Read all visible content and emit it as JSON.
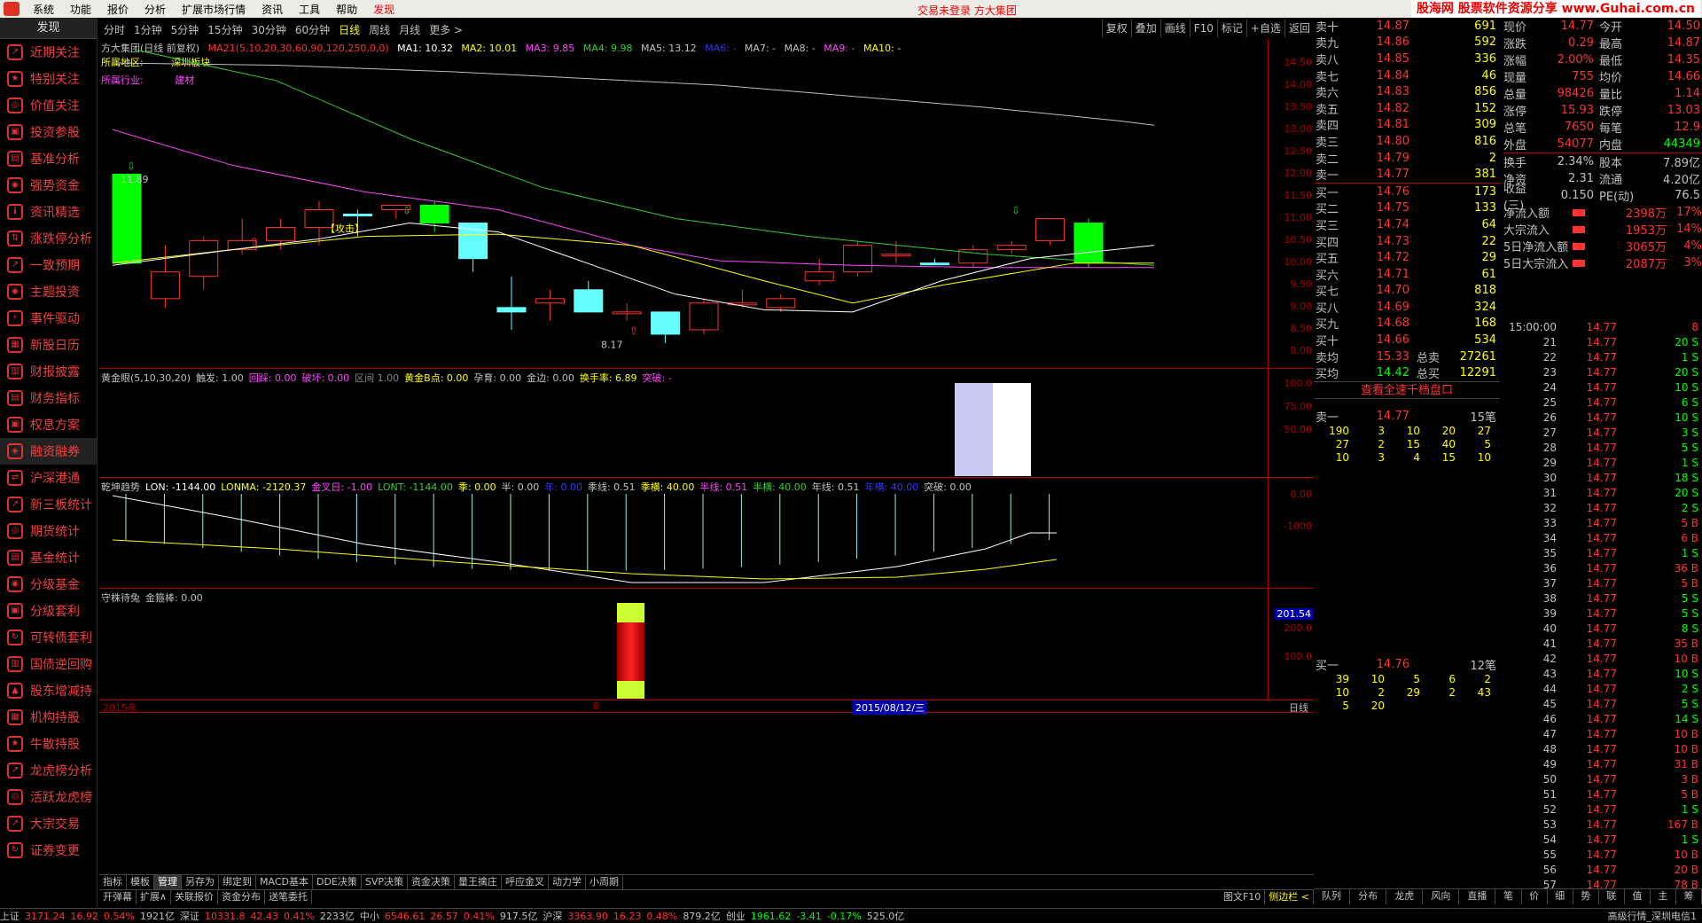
{
  "menubar": {
    "items": [
      "系统",
      "功能",
      "报价",
      "分析",
      "扩展市场行情",
      "资讯",
      "工具",
      "帮助",
      "发现"
    ],
    "status_text": "交易未登录    方大集团",
    "brand": "股海网 股票软件资源分享 www.Guhai.com.cn"
  },
  "sidebar": {
    "header": "发现",
    "items": [
      "近期关注",
      "特别关注",
      "价值关注",
      "投资参股",
      "基准分析",
      "强势资金",
      "资讯精选",
      "涨跌停分析",
      "一致预期",
      "主题投资",
      "事件驱动",
      "新股日历",
      "财报披露",
      "财务指标",
      "权息方案",
      "融资融券",
      "沪深港通",
      "新三板统计",
      "期货统计",
      "基金统计",
      "分级基金",
      "分级套利",
      "可转债套利",
      "国债逆回购",
      "股东增减持",
      "机构持股",
      "牛散持股",
      "龙虎榜分析",
      "活跃龙虎榜",
      "大宗交易",
      "证券变更"
    ]
  },
  "periods": [
    "分时",
    "1分钟",
    "5分钟",
    "15分钟",
    "30分钟",
    "60分钟",
    "日线",
    "周线",
    "月线",
    "更多 >"
  ],
  "right_tools": [
    "复权",
    "叠加",
    "画线",
    "F10",
    "标记",
    "+自选",
    "返回"
  ],
  "chart_header": {
    "name": "方大集团(日线 前复权)",
    "ma_formula": "MA21(5,10,20,30,60,90,120,250,0,0)",
    "mas": [
      "MA1: 10.32",
      "MA2: 10.01",
      "MA3: 9.85",
      "MA4: 9.98",
      "MA5: 13.12",
      "MA6: -",
      "MA7: -",
      "MA8: -",
      "MA9: -",
      "MA10: -"
    ],
    "region_label": "所属地区:",
    "region_value": "深圳板块",
    "industry_label": "所属行业:",
    "industry_value": "建材",
    "high_mark": "11.89",
    "low_mark": "8.17",
    "attack_label": "【攻击】",
    "y_ticks": [
      "14.50",
      "14.00",
      "13.50",
      "13.00",
      "12.50",
      "12.00",
      "11.50",
      "11.00",
      "10.50",
      "10.00",
      "9.50",
      "9.00",
      "8.50",
      "8.00"
    ]
  },
  "pane2": {
    "labels": [
      "黄金眼(5,10,30,20)",
      "触发: 1.00",
      "回踩: 0.00",
      "破坏: 0.00",
      "区间 1.00",
      "黄金B点: 0.00",
      "孕育: 0.00",
      "金边: 0.00",
      "换手率: 6.89",
      "突破: -"
    ],
    "y_ticks": [
      "100.0",
      "75.00",
      "50.00"
    ]
  },
  "pane3": {
    "labels": [
      "乾坤趋势",
      "LON: -1144.00",
      "LONMA: -2120.37",
      "金叉日: -1.00",
      "LONT: -1144.00",
      "季: 0.00",
      "半: 0.00",
      "年: 0.00",
      "季线: 0.51",
      "季横: 40.00",
      "半线: 0.51",
      "半横: 40.00",
      "年线: 0.51",
      "年横: 40.00",
      "突破: 0.00"
    ],
    "y_ticks": [
      "0.00",
      "-1000"
    ]
  },
  "pane4": {
    "labels": [
      "守株待兔",
      "金箍棒: 0.00"
    ],
    "y_ticks": [
      "200.0",
      "100.0"
    ],
    "value_tag": "201.54"
  },
  "xaxis": {
    "left": "2015年",
    "mid": "8",
    "date": "2015/08/12/三",
    "period": "日线"
  },
  "bottom_tabs": [
    "指标",
    "模板",
    "管理",
    "另存为",
    "绑定到",
    "MACD基本",
    "DDE决策",
    "SVP决策",
    "资金决策",
    "量王擒庄",
    "呼应金叉",
    "动力学",
    "小周期"
  ],
  "bottom_tabs2": [
    "开弹幕",
    "扩展∧",
    "关联报价",
    "资金分布",
    "送笔委托"
  ],
  "bottom_right": [
    "图文F10",
    "侧边栏 <"
  ],
  "orderbook": {
    "sells": [
      [
        "卖十",
        "14.87",
        "691"
      ],
      [
        "卖九",
        "14.86",
        "592"
      ],
      [
        "卖八",
        "14.85",
        "336"
      ],
      [
        "卖七",
        "14.84",
        "46"
      ],
      [
        "卖六",
        "14.83",
        "856"
      ],
      [
        "卖五",
        "14.82",
        "152"
      ],
      [
        "卖四",
        "14.81",
        "309"
      ],
      [
        "卖三",
        "14.80",
        "816"
      ],
      [
        "卖二",
        "14.79",
        "2"
      ],
      [
        "卖一",
        "14.77",
        "381"
      ]
    ],
    "buys": [
      [
        "买一",
        "14.76",
        "173"
      ],
      [
        "买二",
        "14.75",
        "133"
      ],
      [
        "买三",
        "14.74",
        "64"
      ],
      [
        "买四",
        "14.73",
        "22"
      ],
      [
        "买五",
        "14.72",
        "29"
      ],
      [
        "买六",
        "14.71",
        "61"
      ],
      [
        "买七",
        "14.70",
        "818"
      ],
      [
        "买八",
        "14.69",
        "324"
      ],
      [
        "买九",
        "14.68",
        "168"
      ],
      [
        "买十",
        "14.66",
        "534"
      ]
    ],
    "avg": [
      [
        "卖均",
        "15.33",
        "总卖",
        "27261"
      ],
      [
        "买均",
        "14.42",
        "总买",
        "12291"
      ]
    ],
    "view_all": "查看全速千档盘口",
    "sell1_queue": {
      "label": "卖一",
      "price": "14.77",
      "count": "15笔",
      "rows": [
        [
          "190",
          "3",
          "10",
          "20",
          "27"
        ],
        [
          "27",
          "2",
          "15",
          "40",
          "5"
        ],
        [
          "10",
          "3",
          "4",
          "15",
          "10"
        ]
      ]
    },
    "buy1_queue": {
      "label": "买一",
      "price": "14.76",
      "count": "12笔",
      "rows": [
        [
          "39",
          "10",
          "5",
          "6",
          "2"
        ],
        [
          "10",
          "2",
          "29",
          "2",
          "43"
        ],
        [
          "5",
          "20",
          "",
          "",
          ""
        ]
      ]
    }
  },
  "stats": [
    [
      "现价",
      "14.77",
      "今开",
      "14.50"
    ],
    [
      "涨跌",
      "0.29",
      "最高",
      "14.87"
    ],
    [
      "涨幅",
      "2.00%",
      "最低",
      "14.35"
    ],
    [
      "现量",
      "755",
      "均价",
      "14.66"
    ],
    [
      "总量",
      "98426",
      "量比",
      "1.14"
    ],
    [
      "涨停",
      "15.93",
      "跌停",
      "13.03"
    ],
    [
      "总笔",
      "7650",
      "每笔",
      "12.9"
    ],
    [
      "外盘",
      "54077",
      "内盘",
      "44349"
    ],
    [
      "换手",
      "2.34%",
      "股本",
      "7.89亿"
    ],
    [
      "净资",
      "2.31",
      "流通",
      "4.20亿"
    ],
    [
      "收益(三)",
      "0.150",
      "PE(动)",
      "76.5"
    ]
  ],
  "flows": [
    [
      "净流入额",
      "2398万",
      "17%"
    ],
    [
      "大宗流入",
      "1953万",
      "14%"
    ],
    [
      "5日净流入额",
      "3065万",
      "4%"
    ],
    [
      "5日大宗流入",
      "2087万",
      "3%"
    ]
  ],
  "ticks": [
    [
      "15:00:00",
      "14.77",
      "8"
    ],
    [
      "21",
      "14.77",
      "20 S"
    ],
    [
      "22",
      "14.77",
      "1 S"
    ],
    [
      "23",
      "14.77",
      "20 S"
    ],
    [
      "24",
      "14.77",
      "10 S"
    ],
    [
      "25",
      "14.77",
      "6 S"
    ],
    [
      "26",
      "14.77",
      "10 S"
    ],
    [
      "27",
      "14.77",
      "3 S"
    ],
    [
      "28",
      "14.77",
      "5 S"
    ],
    [
      "29",
      "14.77",
      "1 S"
    ],
    [
      "30",
      "14.77",
      "18 S"
    ],
    [
      "31",
      "14.77",
      "20 S"
    ],
    [
      "32",
      "14.77",
      "2 S"
    ],
    [
      "33",
      "14.77",
      "5 B"
    ],
    [
      "34",
      "14.77",
      "6 B"
    ],
    [
      "35",
      "14.77",
      "1 S"
    ],
    [
      "36",
      "14.77",
      "36 B"
    ],
    [
      "37",
      "14.77",
      "5 B"
    ],
    [
      "38",
      "14.77",
      "5 S"
    ],
    [
      "39",
      "14.77",
      "5 S"
    ],
    [
      "40",
      "14.77",
      "8 S"
    ],
    [
      "41",
      "14.77",
      "35 B"
    ],
    [
      "42",
      "14.77",
      "10 B"
    ],
    [
      "43",
      "14.77",
      "10 S"
    ],
    [
      "44",
      "14.77",
      "2 S"
    ],
    [
      "45",
      "14.77",
      "5 S"
    ],
    [
      "46",
      "14.77",
      "14 S"
    ],
    [
      "47",
      "14.77",
      "10 B"
    ],
    [
      "48",
      "14.77",
      "10 B"
    ],
    [
      "49",
      "14.77",
      "31 B"
    ],
    [
      "50",
      "14.77",
      "3 B"
    ],
    [
      "51",
      "14.77",
      "5 B"
    ],
    [
      "52",
      "14.77",
      "1 S"
    ],
    [
      "53",
      "14.77",
      "167 B"
    ],
    [
      "54",
      "14.77",
      "1 S"
    ],
    [
      "55",
      "14.77",
      "10 B"
    ],
    [
      "56",
      "14.77",
      "20 B"
    ],
    [
      "57",
      "14.77",
      "78 B"
    ]
  ],
  "right_tabs": [
    "队列",
    "分布",
    "龙虎",
    "风向",
    "直播",
    "笔",
    "价",
    "细",
    "势",
    "联",
    "值",
    "主",
    "筹"
  ],
  "statusbar": [
    [
      "上证",
      "3171.24",
      "16.92",
      "0.54%",
      "1921亿"
    ],
    [
      "深证",
      "10331.8",
      "42.43",
      "0.41%",
      "2233亿"
    ],
    [
      "中小",
      "6546.61",
      "26.57",
      "0.41%",
      "917.5亿"
    ],
    [
      "沪深",
      "3363.90",
      "16.23",
      "0.48%",
      "879.2亿"
    ],
    [
      "创业",
      "1961.62",
      "-3.41",
      "-0.17%",
      "525.0亿"
    ]
  ],
  "status_right": "高级行情_深圳电信1",
  "colors": {
    "up": "#ff3333",
    "down": "#00ff00",
    "ma1": "#ffffff",
    "ma2": "#ffff00",
    "ma3": "#ff44ff",
    "ma4": "#33cc33",
    "ma5": "#c0c0c0",
    "accent": "#aa0000"
  }
}
